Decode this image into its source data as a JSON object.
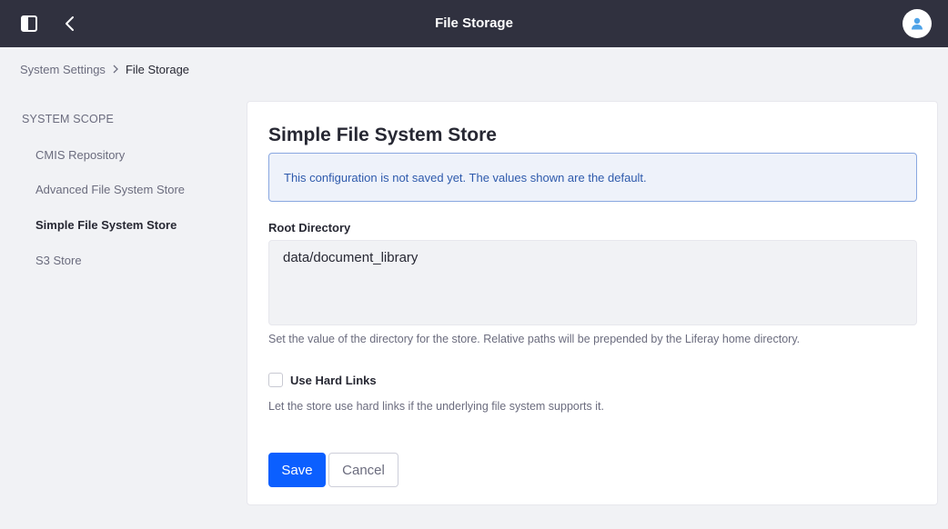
{
  "app": {
    "title": "File Storage",
    "icons": {
      "sidebar_toggle": "sidebar-panel-icon",
      "back": "chevron-left-icon",
      "user": "user-icon"
    }
  },
  "breadcrumb": {
    "items": [
      "System Settings",
      "File Storage"
    ],
    "separator_icon": "chevron-right-icon"
  },
  "sidebar": {
    "heading": "SYSTEM SCOPE",
    "items": [
      {
        "label": "CMIS Repository",
        "active": false
      },
      {
        "label": "Advanced File System Store",
        "active": false
      },
      {
        "label": "Simple File System Store",
        "active": true
      },
      {
        "label": "S3 Store",
        "active": false
      }
    ]
  },
  "form": {
    "title": "Simple File System Store",
    "alert": "This configuration is not saved yet. The values shown are the default.",
    "root_directory": {
      "label": "Root Directory",
      "value": "data/document_library",
      "help": "Set the value of the directory for the store. Relative paths will be prepended by the Liferay home directory."
    },
    "hard_links": {
      "label": "Use Hard Links",
      "checked": false,
      "help": "Let the store use hard links if the underlying file system supports it."
    },
    "save_label": "Save",
    "cancel_label": "Cancel"
  },
  "colors": {
    "topbar": "#30313f",
    "primary": "#0b5fff",
    "alert_text": "#2e5aac",
    "alert_bg": "#eef2fa"
  }
}
